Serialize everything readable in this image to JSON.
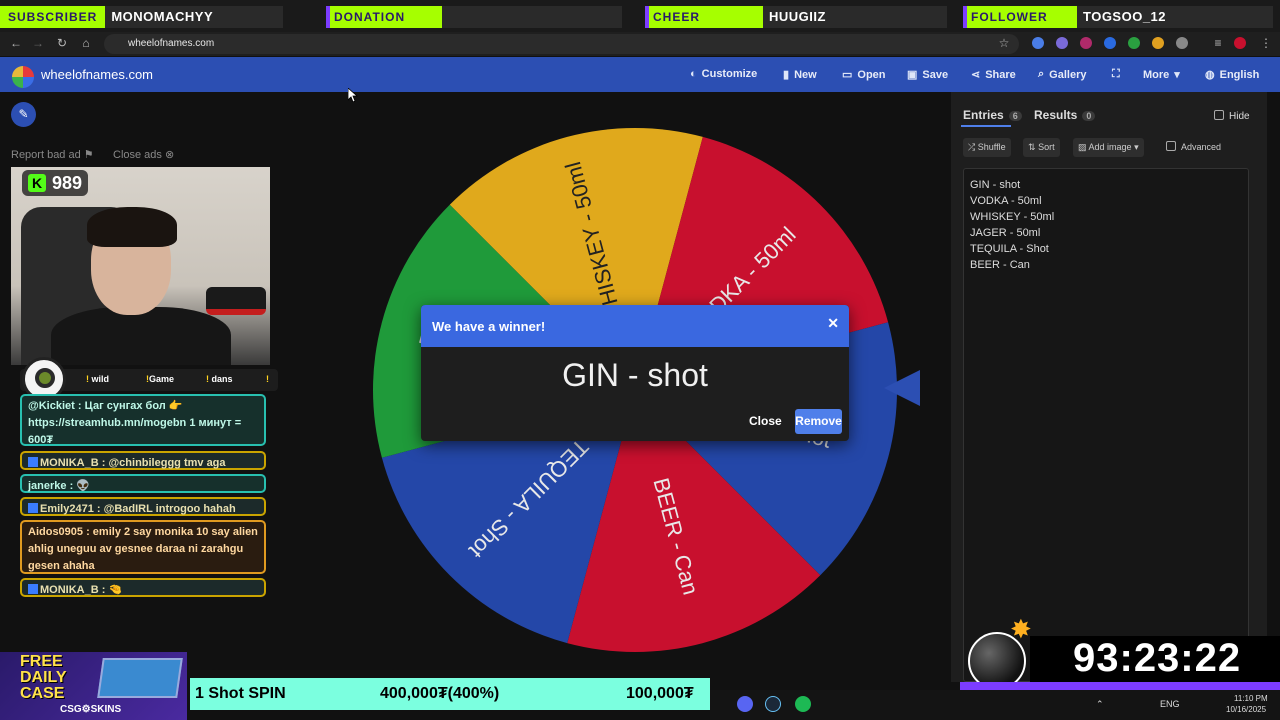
{
  "alerts": [
    {
      "tag": "SUBSCRIBER",
      "name": "MONOMACHYY"
    },
    {
      "tag": "DONATION",
      "name": ""
    },
    {
      "tag": "CHEER",
      "name": "HUUGIIZ"
    },
    {
      "tag": "FOLLOWER",
      "name": "TOGSOO_12"
    }
  ],
  "browser": {
    "url": "wheelofnames.com"
  },
  "site": {
    "name": "wheelofnames.com",
    "nav": [
      "Customize",
      "New",
      "Open",
      "Save",
      "Share",
      "Gallery",
      "More",
      "English"
    ]
  },
  "left": {
    "report_ad": "Report bad ad",
    "close_ads": "Close ads"
  },
  "stream": {
    "kick_count": "989",
    "commands": [
      "wild",
      "Game",
      "dans"
    ],
    "chat": [
      {
        "text": "@Kickiet : Цаг сунгах бол 👉 https://streamhub.mn/mogebn 1 минут = 600₮"
      },
      {
        "text": "MONIKA_B : @chinbileggg tmv aga"
      },
      {
        "text": "janerke : 👽"
      },
      {
        "text": "Emily2471 : @BadIRL introgoo hahah"
      },
      {
        "text": "Aidos0905 : emily 2 say monika 10 say alien ahlig uneguu av gesnee daraa ni zarahgu gesen ahaha"
      },
      {
        "text": "MONIKA_B : 🤏"
      }
    ]
  },
  "wheel": {
    "segments": [
      {
        "label": "WHISKEY - 50ml",
        "color": "#e0a91c"
      },
      {
        "label": "VODKA - 50ml",
        "color": "#c8102e"
      },
      {
        "label": "GIN - shot",
        "color": "#2447a8"
      },
      {
        "label": "BEER - Can",
        "color": "#c8102e"
      },
      {
        "label": "TEQUILA - Shot",
        "color": "#2447a8"
      },
      {
        "label": "JAGER - 50ml",
        "color": "#1f9a3a"
      }
    ]
  },
  "modal": {
    "title": "We have a winner!",
    "winner": "GIN - shot",
    "close": "Close",
    "remove": "Remove"
  },
  "panel": {
    "tab_entries": "Entries",
    "entries_count": "6",
    "tab_results": "Results",
    "results_count": "0",
    "hide": "Hide",
    "shuffle": "Shuffle",
    "sort": "Sort",
    "add_image": "Add image",
    "advanced": "Advanced",
    "entries": [
      "GIN - shot",
      "VODKA - 50ml",
      "WHISKEY - 50ml",
      "JAGER - 50ml",
      "TEQUILA - Shot",
      "BEER - Can"
    ]
  },
  "countdown": "93:23:22",
  "promo": {
    "free": "FREE",
    "daily": "DAILY",
    "case": "CASE",
    "brand": "CSG⚙SKINS"
  },
  "spin": {
    "name": "1 Shot SPIN",
    "amount": "400,000₮(400%)",
    "goal": "100,000₮"
  },
  "taskbar": {
    "lang": "ENG",
    "time": "11:10 PM",
    "date": "10/16/2025"
  },
  "colors": {
    "accent": "#2c4fb3",
    "alert_green": "#a6ff00",
    "spin_bar": "#7bffdf"
  }
}
